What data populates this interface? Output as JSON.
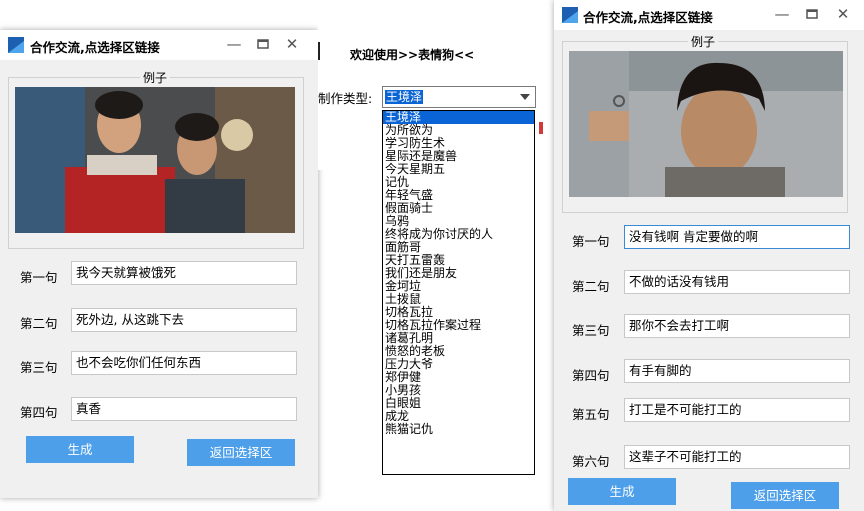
{
  "left_window": {
    "title": "合作交流,点选择区链接",
    "group_legend": "例子",
    "rows": [
      {
        "label": "第一句",
        "value": "我今天就算被饿死"
      },
      {
        "label": "第二句",
        "value": "死外边, 从这跳下去"
      },
      {
        "label": "第三句",
        "value": "也不会吃你们任何东西"
      },
      {
        "label": "第四句",
        "value": "真香"
      }
    ],
    "generate_label": "生成",
    "back_label": "返回选择区"
  },
  "middle": {
    "welcome": "欢迎使用>>表情狗<<",
    "type_label": "制作类型:",
    "selected": "王境泽",
    "options": [
      "王境泽",
      "为所欲为",
      "学习防生术",
      "星际还是魔兽",
      "今天星期五",
      "记仇",
      "年轻气盛",
      "假面骑士",
      "乌鸦",
      "终将成为你讨厌的人",
      "面筋哥",
      "天打五雷轰",
      "我们还是朋友",
      "金坷垃",
      "土拨鼠",
      "切格瓦拉",
      "切格瓦拉作案过程",
      "诸葛孔明",
      "愤怒的老板",
      "压力大爷",
      "郑伊健",
      "小男孩",
      "白眼姐",
      "成龙",
      "熊猫记仇"
    ]
  },
  "right_window": {
    "title": "合作交流,点选择区链接",
    "group_legend": "例子",
    "rows": [
      {
        "label": "第一句",
        "value": "没有钱啊 肯定要做的啊"
      },
      {
        "label": "第二句",
        "value": "不做的话没有钱用"
      },
      {
        "label": "第三句",
        "value": "那你不会去打工啊"
      },
      {
        "label": "第四句",
        "value": "有手有脚的"
      },
      {
        "label": "第五句",
        "value": "打工是不可能打工的"
      },
      {
        "label": "第六句",
        "value": "这辈子不可能打工的"
      }
    ],
    "generate_label": "生成",
    "back_label": "返回选择区"
  },
  "colors": {
    "accent": "#4d9fea",
    "selection": "#0a64d6"
  },
  "icons": [
    "app-icon",
    "minimize-icon",
    "maximize-icon",
    "close-icon",
    "chevron-down-icon"
  ]
}
